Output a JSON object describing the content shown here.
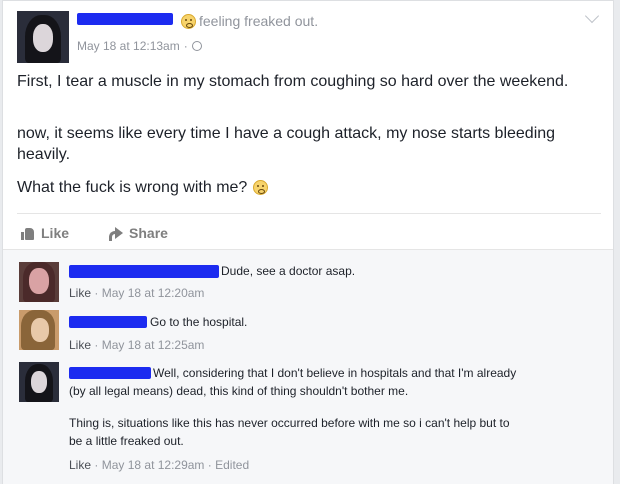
{
  "post": {
    "feeling": "feeling freaked out.",
    "timestamp": "May 18 at 12:13am",
    "paragraph1": "First, I tear a muscle in my stomach from coughing so hard over the weekend.",
    "paragraph2": "now, it seems like every time I have a cough attack, my nose starts bleeding heavily.",
    "paragraph3": "What the fuck is wrong with me?",
    "emoji_icon": "confused-face-icon"
  },
  "actions": {
    "like_label": "Like",
    "share_label": "Share"
  },
  "comments": [
    {
      "text": "Dude, see a doctor asap.",
      "like": "Like",
      "sep": "·",
      "time": "May 18 at 12:20am"
    },
    {
      "text": "Go to the hospital.",
      "like": "Like",
      "sep": "·",
      "time": "May 18 at 12:25am"
    },
    {
      "text": "Well, considering that I don't believe in hospitals and that I'm already",
      "text2": "(by all legal means) dead, this kind of thing shouldn't bother me.",
      "text3": "Thing is, situations like this has never occurred before with me so i can't help but to",
      "text4": "be a little freaked out.",
      "like": "Like",
      "sep": "·",
      "time": "May 18 at 12:29am",
      "edited": "Edited"
    }
  ],
  "colors": {
    "redaction": "#1c2bf0",
    "meta": "#90949c",
    "comment_bg": "#f6f7f9"
  }
}
